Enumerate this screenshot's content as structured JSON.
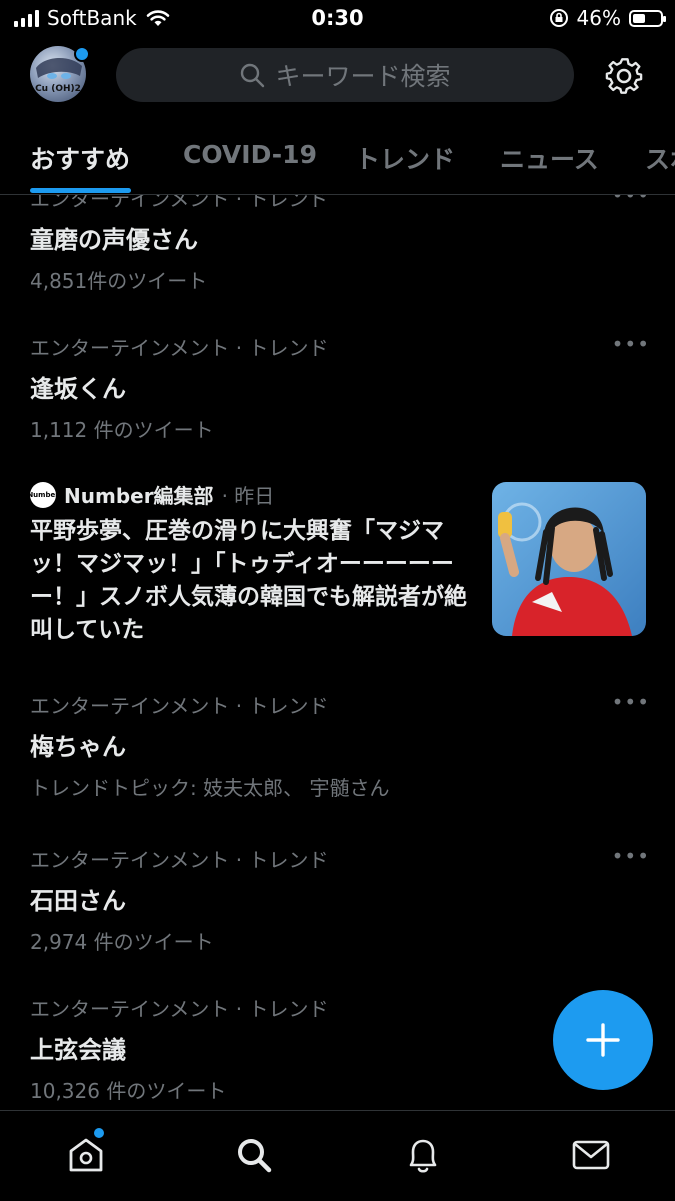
{
  "status_bar": {
    "carrier": "SoftBank",
    "time": "0:30",
    "battery": "46%",
    "battery_level": 0.46
  },
  "header": {
    "avatar_text": "Cu (OH)2",
    "search_placeholder": "キーワード検索",
    "icons": [
      "search-icon",
      "gear-icon"
    ]
  },
  "tabs": [
    {
      "label": "おすすめ",
      "active": true
    },
    {
      "label": "COVID-19"
    },
    {
      "label": "トレンド"
    },
    {
      "label": "ニュース"
    },
    {
      "label": "スポ"
    }
  ],
  "feed": {
    "more": "•••",
    "trends": [
      {
        "category": "エンターテインメント · トレンド",
        "title": "童磨の声優さん",
        "meta": "4,851件のツイート"
      },
      {
        "category": "エンターテインメント · トレンド",
        "title": "逢坂くん",
        "meta": "1,112 件のツイート"
      },
      {
        "category": "エンターテインメント · トレンド",
        "title": "梅ちゃん",
        "meta": "トレンドトピック: 妓夫太郎、 宇髄さん"
      },
      {
        "category": "エンターテインメント · トレンド",
        "title": "石田さん",
        "meta": "2,974 件のツイート"
      },
      {
        "category": "エンターテインメント · トレンド",
        "title": "上弦会議",
        "meta": "10,326 件のツイート"
      }
    ],
    "news": {
      "logo_text": "Number",
      "source": "Number編集部",
      "time": "· 昨日",
      "headline": "平野歩夢、圧巻の滑りに大興奮「マジマッ！マジマッ！」「トゥディオーーーーーー！」スノボ人気薄の韓国でも解説者が絶叫していた"
    }
  },
  "bottom_nav": {
    "items": [
      "home-icon",
      "search-icon",
      "bell-icon",
      "mail-icon"
    ],
    "active": "search-icon",
    "home_badge": true
  },
  "colors": {
    "accent": "#1d9bf0",
    "background": "#000000",
    "text_primary": "#e7e9ea",
    "text_secondary": "#71767b"
  }
}
